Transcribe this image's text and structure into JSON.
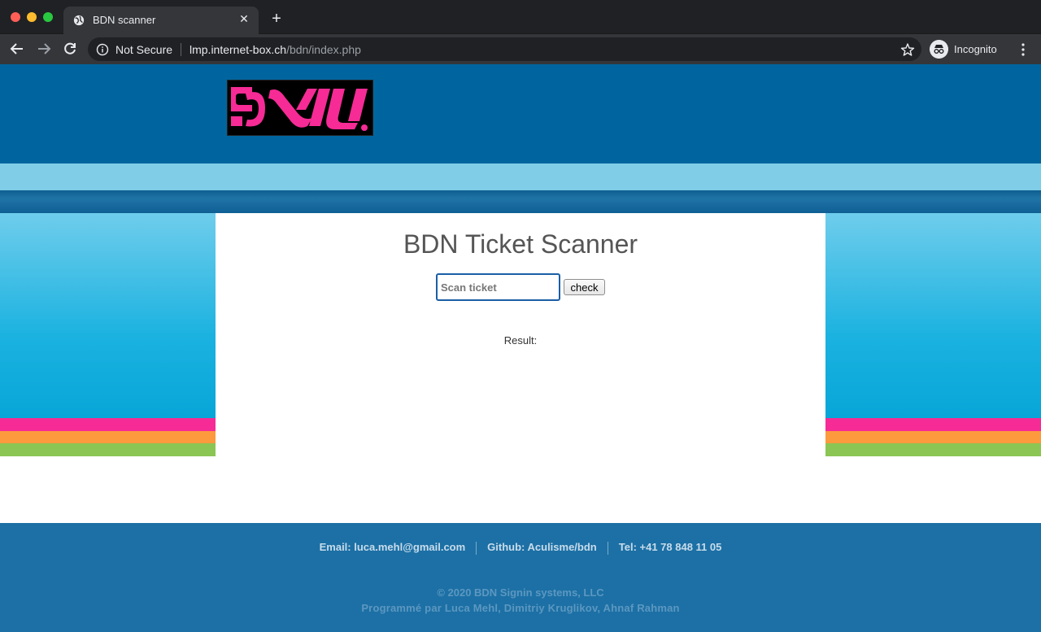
{
  "browser": {
    "tab_title": "BDN scanner",
    "security_label": "Not Secure",
    "url_host": "lmp.internet-box.ch",
    "url_path": "/bdn/index.php",
    "profile_label": "Incognito"
  },
  "page": {
    "title": "BDN Ticket Scanner",
    "scan_placeholder": "Scan ticket",
    "check_label": "check",
    "result_label": "Result:"
  },
  "footer": {
    "email": "Email: luca.mehl@gmail.com",
    "github": "Github: Aculisme/bdn",
    "tel": "Tel: +41 78 848 11 05",
    "copyright": "© 2020 BDN Signin systems, LLC",
    "credits": "Programmé par Luca Mehl, Dimitriy Kruglikov, Ahnaf Rahman"
  },
  "colors": {
    "header": "#00659e",
    "light_band": "#7fcde6",
    "stripe_pink": "#f62b95",
    "stripe_orange": "#fd9a3e",
    "stripe_green": "#8bc554",
    "footer": "#1c70a5",
    "logo_pink": "#f62b95"
  },
  "icons": [
    "globe-icon",
    "close-icon",
    "plus-icon",
    "back-arrow-icon",
    "forward-arrow-icon",
    "reload-icon",
    "info-icon",
    "star-icon",
    "incognito-icon",
    "kebab-menu-icon"
  ]
}
